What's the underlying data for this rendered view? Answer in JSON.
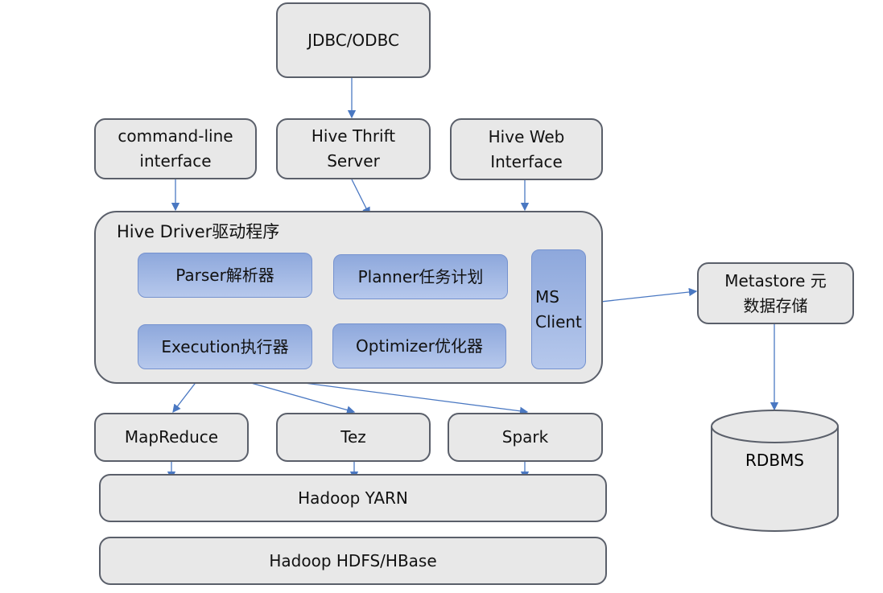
{
  "nodes": {
    "jdbc": "JDBC/ODBC",
    "cli": "command-line interface",
    "thrift": "Hive Thrift Server",
    "web": "Hive Web Interface",
    "driver": "Hive Driver驱动程序",
    "parser": "Parser解析器",
    "planner": "Planner任务计划",
    "execution": "Execution执行器",
    "optimizer": "Optimizer优化器",
    "ms_client": "MS Client",
    "metastore": "Metastore 元数据存储",
    "rdbms": "RDBMS",
    "mapreduce": "MapReduce",
    "tez": "Tez",
    "spark": "Spark",
    "yarn": "Hadoop YARN",
    "hdfs": "Hadoop HDFS/HBase"
  },
  "colors": {
    "box": "#e8e8e8",
    "component": "#9fb7e3",
    "arrow": "#4a78c2"
  }
}
